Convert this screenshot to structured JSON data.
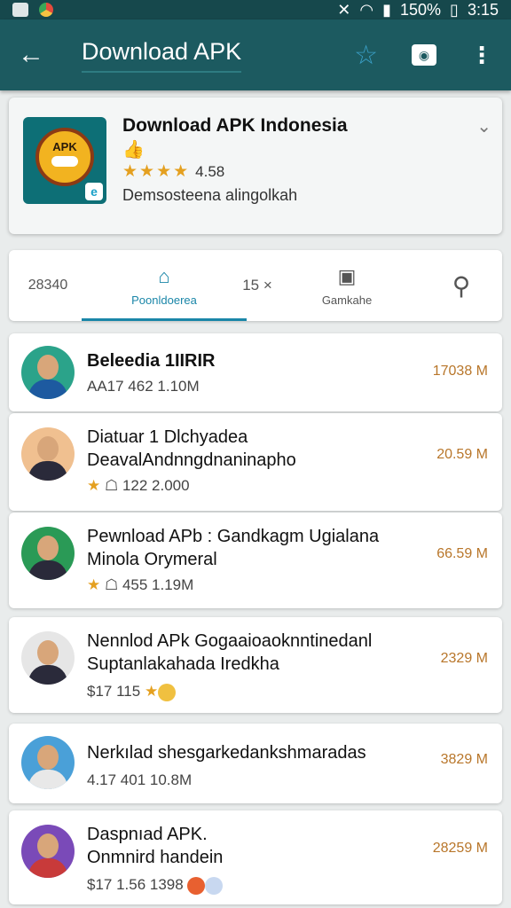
{
  "status_bar": {
    "battery": "150%",
    "time": "3:15"
  },
  "app_bar": {
    "title": "Download APK"
  },
  "header": {
    "name": "Download APK Indonesia",
    "rating": "4.58",
    "subtitle": "Demsosteena alingolkah",
    "logo_text": "APK"
  },
  "tabs": [
    {
      "label": "28340"
    },
    {
      "label": "Poonldoerea"
    },
    {
      "label": "15 ×"
    },
    {
      "label": "Gamkahe"
    },
    {
      "label": ""
    }
  ],
  "items": [
    {
      "title": "Beleedia 1IIRIR",
      "sub": "",
      "meta": "AA17  462  1.10M",
      "size": "17038 M",
      "avatar_color": "#2ba38a"
    },
    {
      "title": "Diatuar 1 Dlchyadea",
      "sub": "DeavalAndnngdnaninapho",
      "meta": "122  2.000",
      "size": "20.59 M",
      "avatar_color": "#f0c090"
    },
    {
      "title": "Pewnload APb : Gandkagm Ugialana",
      "sub": "Minola Orymeral",
      "meta": "455  1.19M",
      "size": "66.59 M",
      "avatar_color": "#2a9a56"
    },
    {
      "title": "Nennlod APk Gogaaioaoknntinedanl",
      "sub": "Suptanlakahada Iredkha",
      "meta": "$17  115",
      "size": "2329 M",
      "avatar_color": "#e6e6e6"
    },
    {
      "title": "Nerkılad shesgarkedankshmaradas",
      "sub": "",
      "meta": "4.17  401  10.8M",
      "size": "3829 M",
      "avatar_color": "#4aa0d8"
    },
    {
      "title": "Daspnıad APK.",
      "sub": "Onmnird handein",
      "meta": "$17  1.56  1398",
      "size": "28259 M",
      "avatar_color": "#7a4ab8"
    }
  ]
}
